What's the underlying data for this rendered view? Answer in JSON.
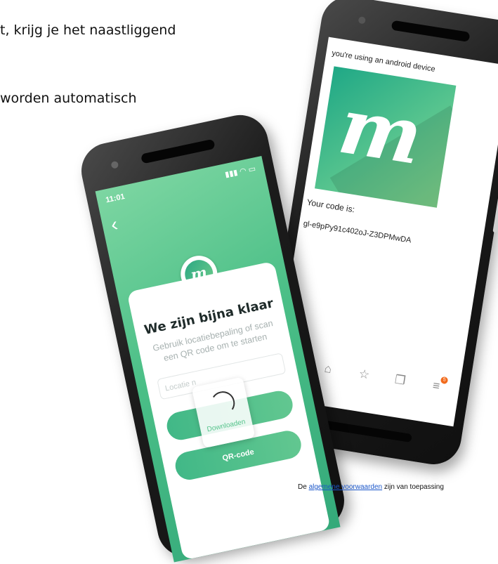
{
  "document": {
    "line1": "t, krijg je het naastliggend",
    "line2": "worden automatisch",
    "footer": {
      "prefix": "De",
      "link_text": "algemene voorwaarden",
      "suffix": "zijn van toepassing"
    }
  },
  "phone_right": {
    "device_message": "you're using an android device",
    "logo_glyph": "m",
    "code_label": "Your code is:",
    "code_value": "gl-e9pPy91c402oJ-Z3DPMwDA",
    "nav_icons": [
      "forward-icon",
      "home-icon",
      "star-icon",
      "tabs-icon",
      "menu-icon"
    ],
    "badge_count": "5",
    "colors": {
      "tile_start": "#1fa886",
      "tile_end": "#7ed18b",
      "badge": "#f26b1d"
    }
  },
  "phone_left": {
    "status_time": "11:01",
    "logo_glyph": "m",
    "title": "We zijn bijna klaar",
    "subtitle": "Gebruik locatiebepaling of scan een QR code om te starten",
    "location_placeholder": "Locatie n",
    "loading_label": "Downloaden",
    "qr_button_label": "QR-code",
    "colors": {
      "accent": "#4bbf87"
    }
  }
}
